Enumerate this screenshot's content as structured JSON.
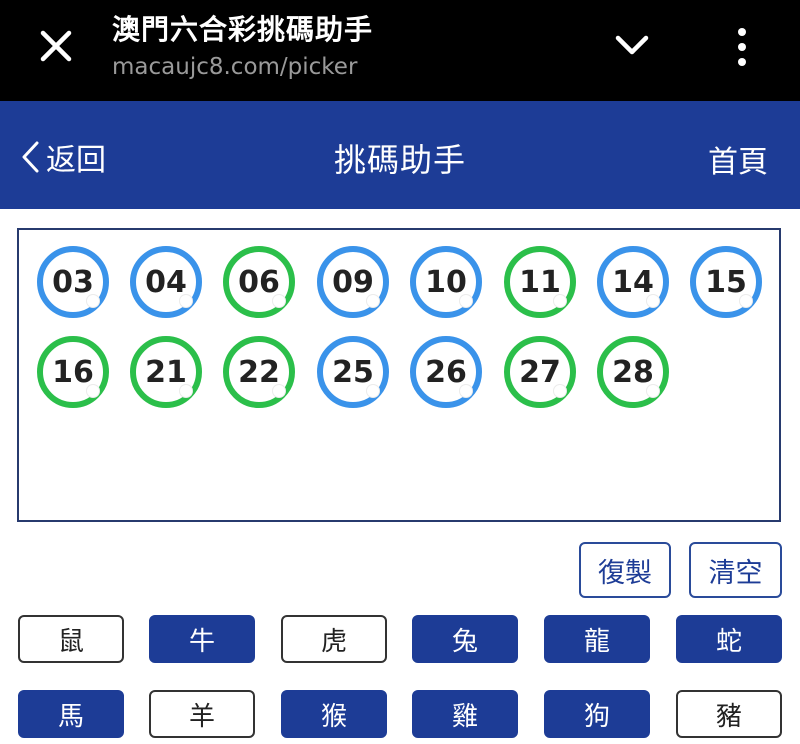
{
  "browser": {
    "title": "澳門六合彩挑碼助手",
    "url": "macaujc8.com/picker"
  },
  "nav": {
    "back_label": "返回",
    "title": "挑碼助手",
    "home_label": "首頁"
  },
  "balls": [
    {
      "num": "03",
      "color": "blue"
    },
    {
      "num": "04",
      "color": "blue"
    },
    {
      "num": "06",
      "color": "green"
    },
    {
      "num": "09",
      "color": "blue"
    },
    {
      "num": "10",
      "color": "blue"
    },
    {
      "num": "11",
      "color": "green"
    },
    {
      "num": "14",
      "color": "blue"
    },
    {
      "num": "15",
      "color": "blue"
    },
    {
      "num": "16",
      "color": "green"
    },
    {
      "num": "21",
      "color": "green"
    },
    {
      "num": "22",
      "color": "green"
    },
    {
      "num": "25",
      "color": "blue"
    },
    {
      "num": "26",
      "color": "blue"
    },
    {
      "num": "27",
      "color": "green"
    },
    {
      "num": "28",
      "color": "green"
    }
  ],
  "actions": {
    "copy_label": "復製",
    "clear_label": "清空"
  },
  "zodiacs": [
    {
      "label": "鼠",
      "selected": false
    },
    {
      "label": "牛",
      "selected": true
    },
    {
      "label": "虎",
      "selected": false
    },
    {
      "label": "兔",
      "selected": true
    },
    {
      "label": "龍",
      "selected": true
    },
    {
      "label": "蛇",
      "selected": true
    },
    {
      "label": "馬",
      "selected": true
    },
    {
      "label": "羊",
      "selected": false
    },
    {
      "label": "猴",
      "selected": true
    },
    {
      "label": "雞",
      "selected": true
    },
    {
      "label": "狗",
      "selected": true
    },
    {
      "label": "豬",
      "selected": false
    }
  ],
  "colors": {
    "nav_blue": "#1d3c96",
    "ball_blue": "#3a93ea",
    "ball_green": "#2bbf4a"
  },
  "icons": {
    "close": "close-icon",
    "menu_toggle": "chevron-down-icon",
    "more": "more-vertical-icon",
    "back": "chevron-left-icon"
  }
}
